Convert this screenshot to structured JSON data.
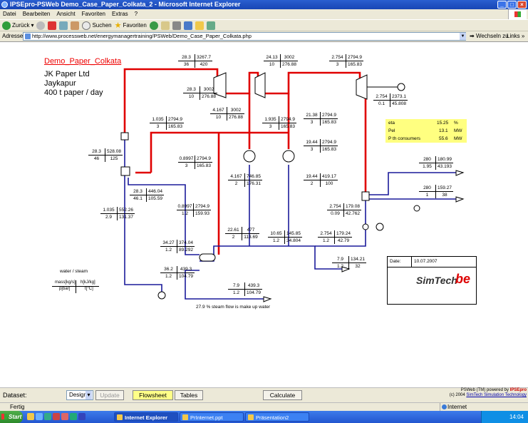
{
  "window": {
    "title": "IPSEpro-PSWeb Demo_Case_Paper_Colkata_2 - Microsoft Internet Explorer",
    "buttons": [
      "_",
      "□",
      "×"
    ]
  },
  "menu": [
    "Datei",
    "Bearbeiten",
    "Ansicht",
    "Favoriten",
    "Extras",
    "?"
  ],
  "toolbar": {
    "back": "Zurück",
    "search": "Suchen",
    "favorites": "Favoriten"
  },
  "address": {
    "label": "Adresse",
    "url": "http://www.processweb.net/energymanagertraining/PSWeb/Demo_Case_Paper_Colkata.php",
    "go": "Wechseln zu",
    "links": "Links »"
  },
  "page": {
    "title_link": "Demo_Paper_Colkata",
    "company": [
      "JK Paper Ltd",
      "Jaykapur",
      "400 t paper / day"
    ],
    "eta_box": [
      {
        "label": "eta",
        "value": "15.25",
        "unit": "%"
      },
      {
        "label": "Pel",
        "value": "13.1",
        "unit": "MW"
      },
      {
        "label": "P th consumers",
        "value": "55.6",
        "unit": "MW"
      }
    ],
    "legend_title": "water / steam",
    "legend_cells": [
      "mass[kg/s]",
      "h[kJ/kg]",
      "p[bar]",
      "t[°C]"
    ],
    "date_label": "Date:",
    "date_value": "10.07.2007",
    "logo_text": "SimTech",
    "logo_be": "be",
    "note": "27.9   % steam flow is make up water",
    "value_boxes": [
      {
        "m": "28.3",
        "h": "3267.7",
        "p": "36",
        "t": "420"
      },
      {
        "m": "24.13",
        "h": "3002",
        "p": "10",
        "t": "276.88"
      },
      {
        "m": "2.754",
        "h": "2794.9",
        "p": "3",
        "t": "165.83"
      },
      {
        "m": "28.3",
        "h": "3002",
        "p": "10",
        "t": "276.88"
      },
      {
        "m": "2.754",
        "h": "2373.1",
        "p": "0.1",
        "t": "45.808"
      },
      {
        "m": "4.167",
        "h": "3002",
        "p": "10",
        "t": "276.88"
      },
      {
        "m": "1.035",
        "h": "2794.9",
        "p": "3",
        "t": "165.83"
      },
      {
        "m": "1.935",
        "h": "2794.9",
        "p": "3",
        "t": "165.83"
      },
      {
        "m": "21.38",
        "h": "2794.9",
        "p": "3",
        "t": "165.83"
      },
      {
        "m": "19.44",
        "h": "2794.9",
        "p": "3",
        "t": "165.83"
      },
      {
        "m": "28.3",
        "h": "528.08",
        "p": "46",
        "t": "125"
      },
      {
        "m": "0.8997",
        "h": "2794.9",
        "p": "3",
        "t": "165.83"
      },
      {
        "m": "280",
        "h": "180.99",
        "p": "1.95",
        "t": "43.193"
      },
      {
        "m": "4.167",
        "h": "746.85",
        "p": "2",
        "t": "176.31"
      },
      {
        "m": "19.44",
        "h": "419.17",
        "p": "2",
        "t": "100"
      },
      {
        "m": "280",
        "h": "159.27",
        "p": "1",
        "t": "38"
      },
      {
        "m": "28.3",
        "h": "446.04",
        "p": "46.1",
        "t": "105.59"
      },
      {
        "m": "1.035",
        "h": "552.26",
        "p": "2.9",
        "t": "131.37"
      },
      {
        "m": "0.8997",
        "h": "2794.9",
        "p": "1.2",
        "t": "159.93"
      },
      {
        "m": "2.754",
        "h": "179.08",
        "p": "0.09",
        "t": "42.762"
      },
      {
        "m": "22.61",
        "h": "477",
        "p": "2",
        "t": "113.69"
      },
      {
        "m": "10.65",
        "h": "145.85",
        "p": "1.2",
        "t": "34.804"
      },
      {
        "m": "2.754",
        "h": "179.24",
        "p": "1.2",
        "t": "42.79"
      },
      {
        "m": "34.27",
        "h": "374.04",
        "p": "1.2",
        "t": "89.292"
      },
      {
        "m": "7.9",
        "h": "134.21",
        "p": "1.2",
        "t": "32"
      },
      {
        "m": "36.2",
        "h": "439.3",
        "p": "1.2",
        "t": "104.79"
      },
      {
        "m": "7.9",
        "h": "439.3",
        "p": "1.2",
        "t": "104.79"
      }
    ]
  },
  "appbar": {
    "dataset_label": "Dataset:",
    "dataset_value": "Design",
    "update": "Update",
    "flowsheet": "Flowsheet",
    "tables": "Tables",
    "calculate": "Calculate",
    "psweb_line1": "PSWeb (TM)  powered by",
    "psweb_brand": "IPSEpro",
    "psweb_line2": "(c) 2004",
    "psweb_sim": "SimTech Simulation Technology"
  },
  "status": {
    "text": "Fertig",
    "zone": "Internet"
  },
  "taskbar": {
    "start": "Start",
    "tasks": [
      "Internet Explorer",
      "PrInternet.ppt",
      "Präsentation2"
    ],
    "clock": "14:04"
  },
  "colors": {
    "steam": "#e00000",
    "water": "#1a1a9a",
    "highlight": "#ffff80"
  }
}
